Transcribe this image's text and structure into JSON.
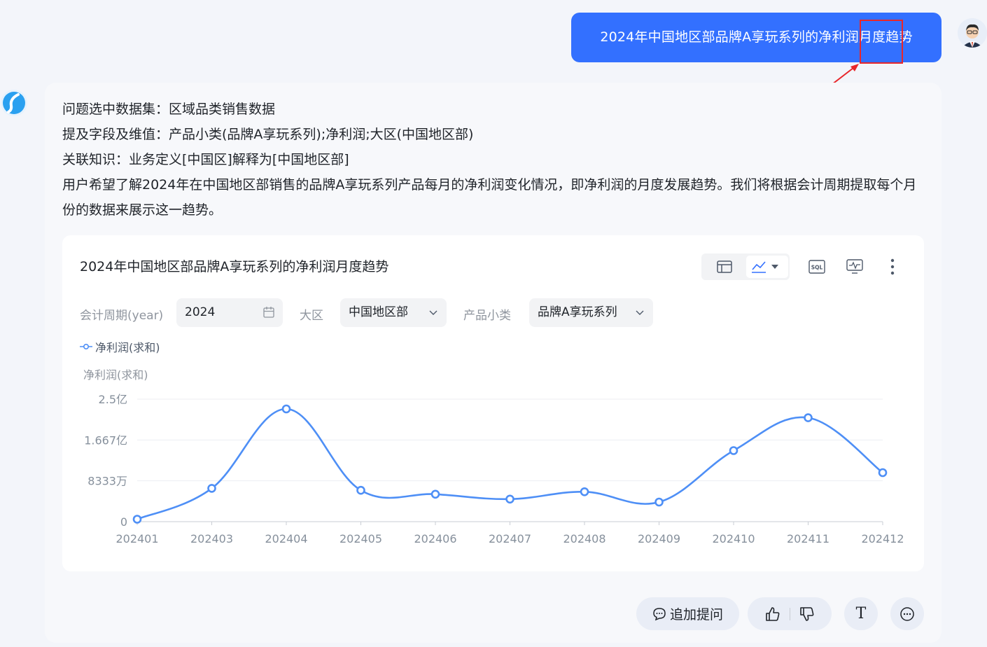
{
  "user_message": "2024年中国地区部品牌A享玩系列的净利润月度趋势",
  "answer": {
    "line1": "问题选中数据集：区域品类销售数据",
    "line2": "提及字段及维值：产品小类(品牌A享玩系列);净利润;大区(中国地区部)",
    "line3": "关联知识：业务定义[中国区]解释为[中国地区部]",
    "line4": "用户希望了解2024年在中国地区部销售的品牌A享玩系列产品每月的净利润变化情况，即净利润的月度发展趋势。我们将根据会计周期提取每个月份的数据来展示这一趋势。"
  },
  "chart_card": {
    "title": "2024年中国地区部品牌A享玩系列的净利润月度趋势",
    "toolbar": {
      "table_icon": "table-icon",
      "line_icon": "line-chart-icon",
      "sql_label": "SQL",
      "monitor_icon": "monitor-icon",
      "more_icon": "more-vertical-icon"
    },
    "filters": {
      "period_label": "会计周期(year)",
      "period_value": "2024",
      "region_label": "大区",
      "region_value": "中国地区部",
      "category_label": "产品小类",
      "category_value": "品牌A享玩系列"
    },
    "legend": "净利润(求和)",
    "y_title": "净利润(求和)"
  },
  "chart_data": {
    "type": "line",
    "x": [
      "202401",
      "202403",
      "202404",
      "202405",
      "202406",
      "202407",
      "202408",
      "202409",
      "202410",
      "202411",
      "202412"
    ],
    "series": [
      {
        "name": "净利润(求和)",
        "values": [
          5000000,
          68000000,
          230000000,
          64000000,
          56000000,
          46000000,
          61000000,
          40000000,
          145000000,
          212000000,
          100000000
        ]
      }
    ],
    "y_ticks": [
      {
        "value": 0,
        "label": "0"
      },
      {
        "value": 83333333,
        "label": "8333万"
      },
      {
        "value": 166666667,
        "label": "1.667亿"
      },
      {
        "value": 250000000,
        "label": "2.5亿"
      }
    ],
    "ylim": [
      0,
      250000000
    ],
    "ylabel": "净利润(求和)",
    "color": "#4e8ff6",
    "grid": true,
    "legend_position": "top-left"
  },
  "actions": {
    "follow_up": "追加提问",
    "text_btn": "T"
  },
  "colors": {
    "primary": "#3370ff",
    "line": "#4e8ff6",
    "annotation": "#e8262a"
  }
}
